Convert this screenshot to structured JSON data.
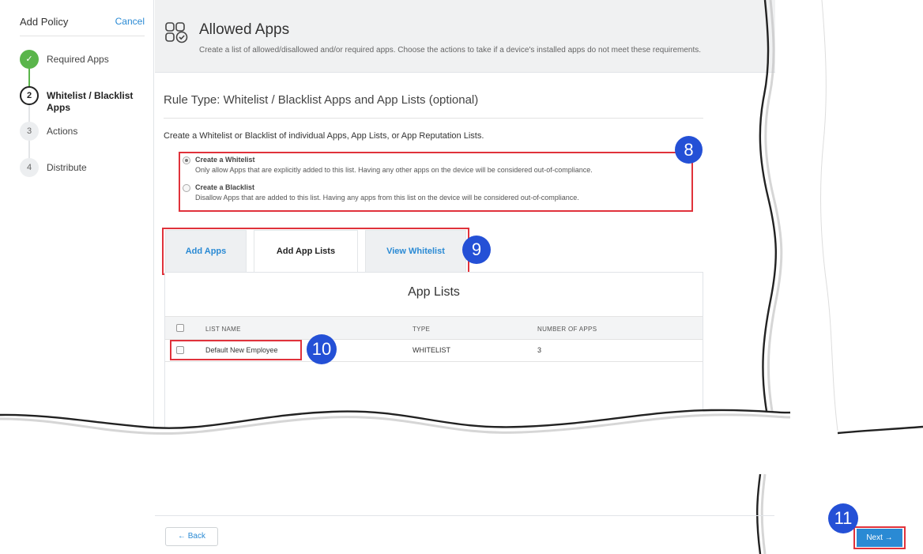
{
  "sidebar": {
    "title": "Add Policy",
    "cancel": "Cancel",
    "steps": [
      {
        "marker": "✓",
        "label": "Required Apps",
        "state": "done"
      },
      {
        "marker": "2",
        "label": "Whitelist / Blacklist Apps",
        "state": "current"
      },
      {
        "marker": "3",
        "label": "Actions",
        "state": "todo"
      },
      {
        "marker": "4",
        "label": "Distribute",
        "state": "todo"
      }
    ]
  },
  "header": {
    "icon": "apps-check-icon",
    "title": "Allowed Apps",
    "description": "Create a list of allowed/disallowed and/or required apps. Choose the actions to take if a device's installed apps do not meet these requirements."
  },
  "main": {
    "rule_type": "Rule Type: Whitelist / Blacklist Apps and App Lists (optional)",
    "intro": "Create a Whitelist or Blacklist of individual Apps, App Lists, or App Reputation Lists.",
    "options": [
      {
        "title": "Create a Whitelist",
        "description": "Only allow Apps that are explicitly added to this list. Having any other apps on the device will be considered out-of-compliance.",
        "selected": true
      },
      {
        "title": "Create a Blacklist",
        "description": "Disallow Apps that are added to this list. Having any apps from this list on the device will be considered out-of-compliance.",
        "selected": false
      }
    ],
    "tabs": [
      {
        "label": "Add Apps",
        "active": false
      },
      {
        "label": "Add App Lists",
        "active": true
      },
      {
        "label": "View Whitelist",
        "active": false
      }
    ],
    "panel_title": "App Lists",
    "table": {
      "columns": [
        "LIST NAME",
        "TYPE",
        "NUMBER OF APPS"
      ],
      "rows": [
        {
          "name": "Default New Employee",
          "type": "WHITELIST",
          "count": "3"
        }
      ]
    }
  },
  "footer": {
    "back": "← Back",
    "next": "Next →"
  },
  "callouts": [
    "8",
    "9",
    "10",
    "11"
  ],
  "colors": {
    "accent": "#2a8ad4",
    "highlight": "#e0323b",
    "callout": "#2450d6",
    "done": "#5ab54b"
  }
}
